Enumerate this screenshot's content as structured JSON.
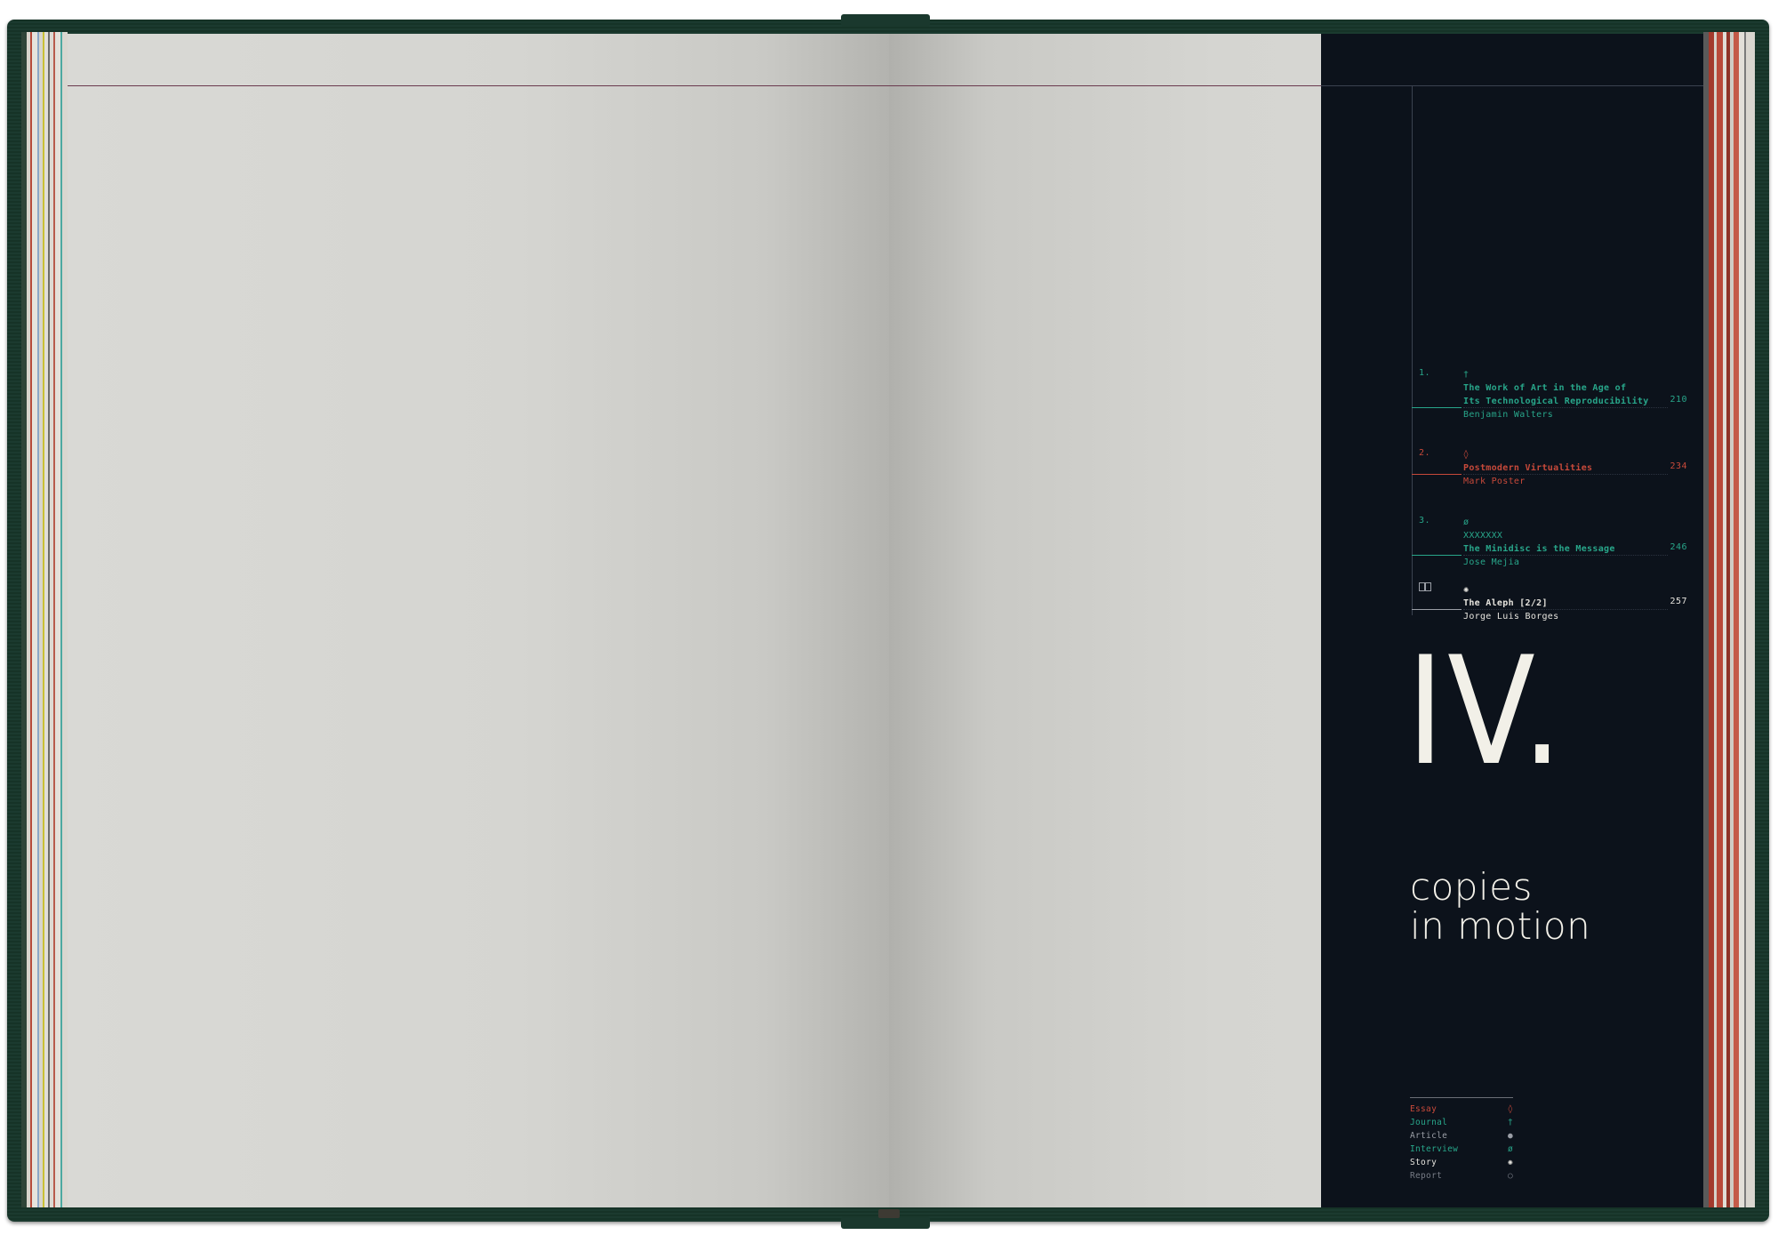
{
  "toc": {
    "entries": [
      {
        "num": "1.",
        "symbol": "†",
        "title_lines": [
          "The Work of Art in the Age of",
          "Its Technological Reproducibility"
        ],
        "author": "Benjamin Walters",
        "page": "210",
        "color": "#28a68a"
      },
      {
        "num": "2.",
        "symbol": "◊",
        "title_lines": [
          "Postmodern Virtualities"
        ],
        "author": "Mark Poster",
        "page": "234",
        "color": "#c7493a"
      },
      {
        "num": "3.",
        "symbol": "ø",
        "tag": "XXXXXXX",
        "title_lines": [
          "The Minidisc is the Message"
        ],
        "author": "Jose Mejia",
        "page": "246",
        "color": "#28a68a"
      },
      {
        "num_icon": "open-book-icon",
        "symbol": "✺",
        "title_lines": [
          "The Aleph [2/2]"
        ],
        "author": "Jorge Luis Borges",
        "page": "257",
        "color": "#e6e4de"
      }
    ]
  },
  "chapter": {
    "number": "IV.",
    "subtitle_line1": "copies",
    "subtitle_line2": "in motion"
  },
  "legend": {
    "items": [
      {
        "label": "Essay",
        "icon": "◊",
        "color": "#c7493a"
      },
      {
        "label": "Journal",
        "icon": "†",
        "color": "#28a68a"
      },
      {
        "label": "Article",
        "icon": "●",
        "color": "#9a9ea6"
      },
      {
        "label": "Interview",
        "icon": "ø",
        "color": "#28a68a"
      },
      {
        "label": "Story",
        "icon": "✺",
        "color": "#e6e4de"
      },
      {
        "label": "Report",
        "icon": "○",
        "color": "#777c86"
      }
    ]
  },
  "colors": {
    "panel": "#0c121b",
    "cover": "#1b3a2f",
    "paper": "#d7d7d3",
    "teal": "#28a68a",
    "red": "#c7493a"
  }
}
